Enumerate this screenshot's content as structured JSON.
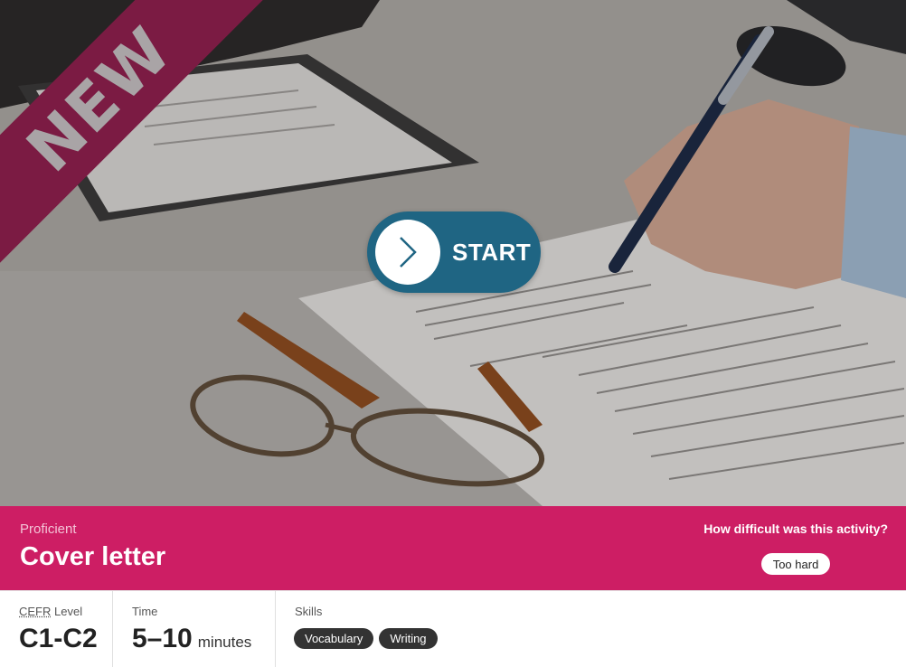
{
  "hero": {
    "ribbon_text": "NEW",
    "start_label": "START",
    "icons": {
      "start": "chevron-right-icon"
    },
    "colors": {
      "ribbon": "#7b1b43",
      "start_button": "#1f6583"
    }
  },
  "band": {
    "level_name": "Proficient",
    "title": "Cover letter",
    "difficulty_question": "How difficult was this activity?",
    "difficulty_option": "Too hard",
    "color": "#cd1e64"
  },
  "info": {
    "cefr_abbr": "CEFR",
    "cefr_label_rest": " Level",
    "cefr_value": "C1-C2",
    "time_label": "Time",
    "time_value": "5–10",
    "time_unit": "minutes",
    "skills_label": "Skills",
    "skills": [
      "Vocabulary",
      "Writing"
    ]
  }
}
